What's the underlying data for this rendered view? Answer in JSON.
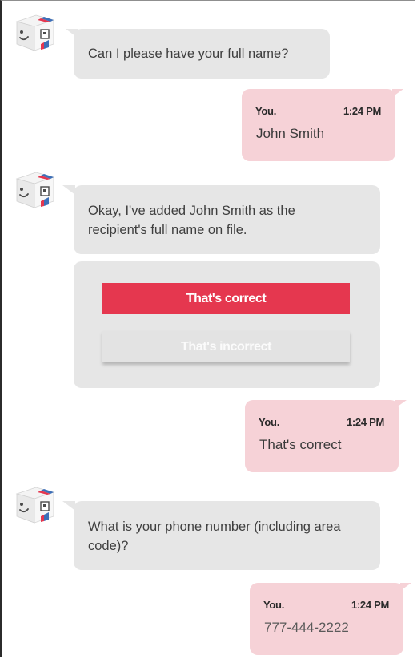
{
  "conversation": {
    "bot_messages": [
      {
        "text": "Can I please have your full name?"
      },
      {
        "text": "Okay, I've added John Smith as the recipient's full name on file."
      },
      {
        "text": "What is your phone number (including area code)?"
      }
    ],
    "user_messages": [
      {
        "sender": "You.",
        "time": "1:24 PM",
        "text": "John Smith"
      },
      {
        "sender": "You.",
        "time": "1:24 PM",
        "text": "That's correct"
      },
      {
        "sender": "You.",
        "time": "1:24 PM",
        "text": "777-444-2222"
      }
    ],
    "choices": {
      "correct_label": "That's correct",
      "incorrect_label": "That's incorrect"
    }
  },
  "colors": {
    "bot_bubble": "#e6e6e6",
    "user_bubble": "#f6d2d7",
    "primary_button": "#e5374f",
    "avatar_blue": "#3d6fb8",
    "avatar_red": "#e5374f"
  },
  "icons": {
    "bot_avatar": "smiling-cube-robot-icon"
  }
}
